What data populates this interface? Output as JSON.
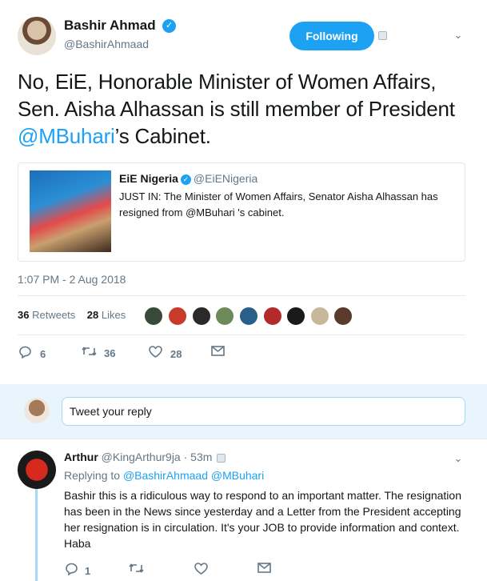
{
  "tweet": {
    "author_name": "Bashir Ahmad",
    "author_handle": "@BashirAhmaad",
    "follow_label": "Following",
    "text_before": "No, EiE, Honorable Minister of Women Affairs, Sen. Aisha Alhassan is still member of President ",
    "text_mention": "@MBuhari",
    "text_after": "’s Cabinet.",
    "timestamp": "1:07 PM - 2 Aug 2018",
    "retweets_count": "36",
    "retweets_label": "Retweets",
    "likes_count": "28",
    "likes_label": "Likes",
    "actions": {
      "reply_count": "6",
      "retweet_count": "36",
      "like_count": "28"
    }
  },
  "quote": {
    "name": "EiE Nigeria",
    "handle": "@EiENigeria",
    "text": "JUST IN: The Minister of Women Affairs, Senator Aisha Alhassan has resigned from @MBuhari 's cabinet."
  },
  "reply_box": {
    "placeholder": "Tweet your reply"
  },
  "reply": {
    "author_name": "Arthur",
    "author_handle": "@KingArthur9ja",
    "time": "· 53m",
    "replying_prefix": "Replying to",
    "replying_mentions": "@BashirAhmaad @MBuhari",
    "text": "Bashir this is a ridiculous way to respond to an important matter. The resignation has been in the News since yesterday and a Letter from the President accepting her resignation is in circulation. It's your JOB to provide information and context. Haba",
    "reply_count": "1"
  },
  "colors": {
    "accent": "#1da1f2",
    "muted": "#657786",
    "reply_bar": "#e8f5fd"
  },
  "icons": {
    "reply": "reply-icon",
    "retweet": "retweet-icon",
    "like": "heart-icon",
    "dm": "envelope-icon",
    "verified": "verified-badge-icon",
    "chevron": "chevron-down-icon"
  }
}
